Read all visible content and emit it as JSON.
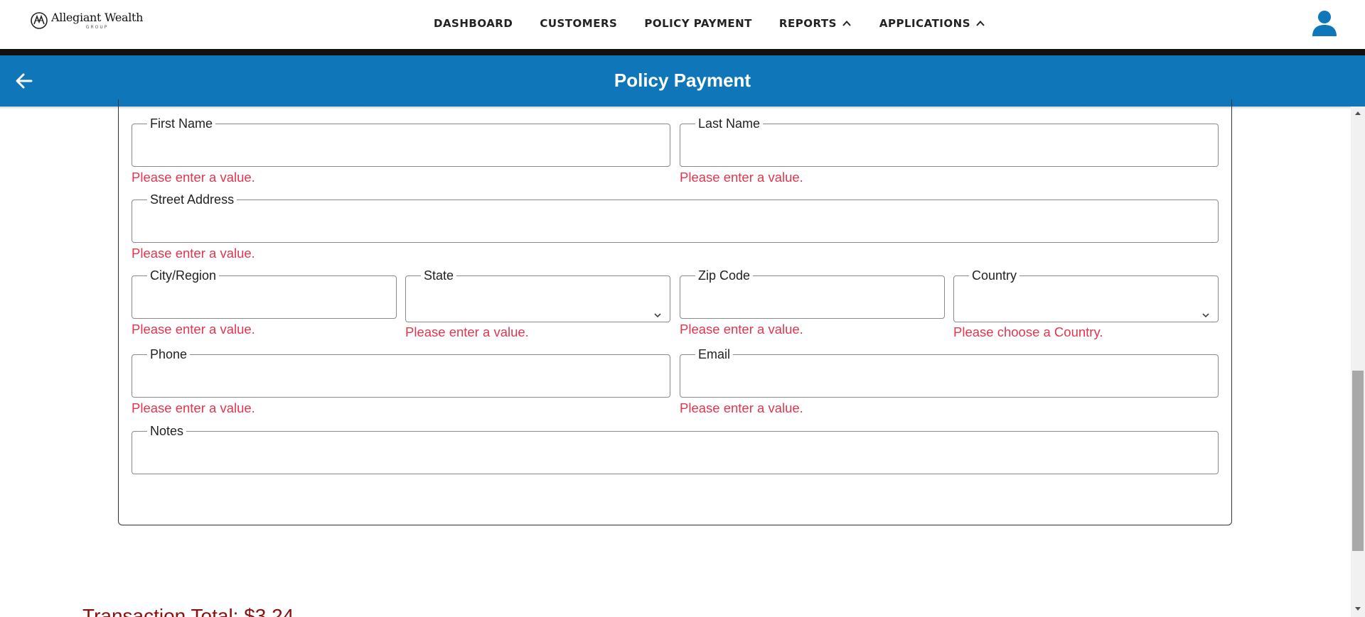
{
  "brand": {
    "name": "Allegiant Wealth",
    "sub": "GROUP"
  },
  "nav": {
    "items": [
      {
        "label": "DASHBOARD"
      },
      {
        "label": "CUSTOMERS"
      },
      {
        "label": "POLICY PAYMENT"
      },
      {
        "label": "REPORTS",
        "icon": "chevron-up-icon"
      },
      {
        "label": "APPLICATIONS",
        "icon": "chevron-up-icon"
      }
    ]
  },
  "header": {
    "title": "Policy Payment"
  },
  "form": {
    "first_name": {
      "label": "First Name",
      "value": "",
      "error": "Please enter a value."
    },
    "last_name": {
      "label": "Last Name",
      "value": "",
      "error": "Please enter a value."
    },
    "street": {
      "label": "Street Address",
      "value": "",
      "error": "Please enter a value."
    },
    "city": {
      "label": "City/Region",
      "value": "",
      "error": "Please enter a value."
    },
    "state": {
      "label": "State",
      "value": "",
      "error": "Please enter a value."
    },
    "zip": {
      "label": "Zip Code",
      "value": "",
      "error": "Please enter a value."
    },
    "country": {
      "label": "Country",
      "value": "",
      "error": "Please choose a Country."
    },
    "phone": {
      "label": "Phone",
      "value": "",
      "error": "Please enter a value."
    },
    "email": {
      "label": "Email",
      "value": "",
      "error": "Please enter a value."
    },
    "notes": {
      "label": "Notes",
      "value": ""
    }
  },
  "transaction_total": "Transaction Total: $3.24",
  "colors": {
    "header_blue": "#0e76b9",
    "error_red": "#e1364e",
    "total_red": "#8b0f0f"
  }
}
